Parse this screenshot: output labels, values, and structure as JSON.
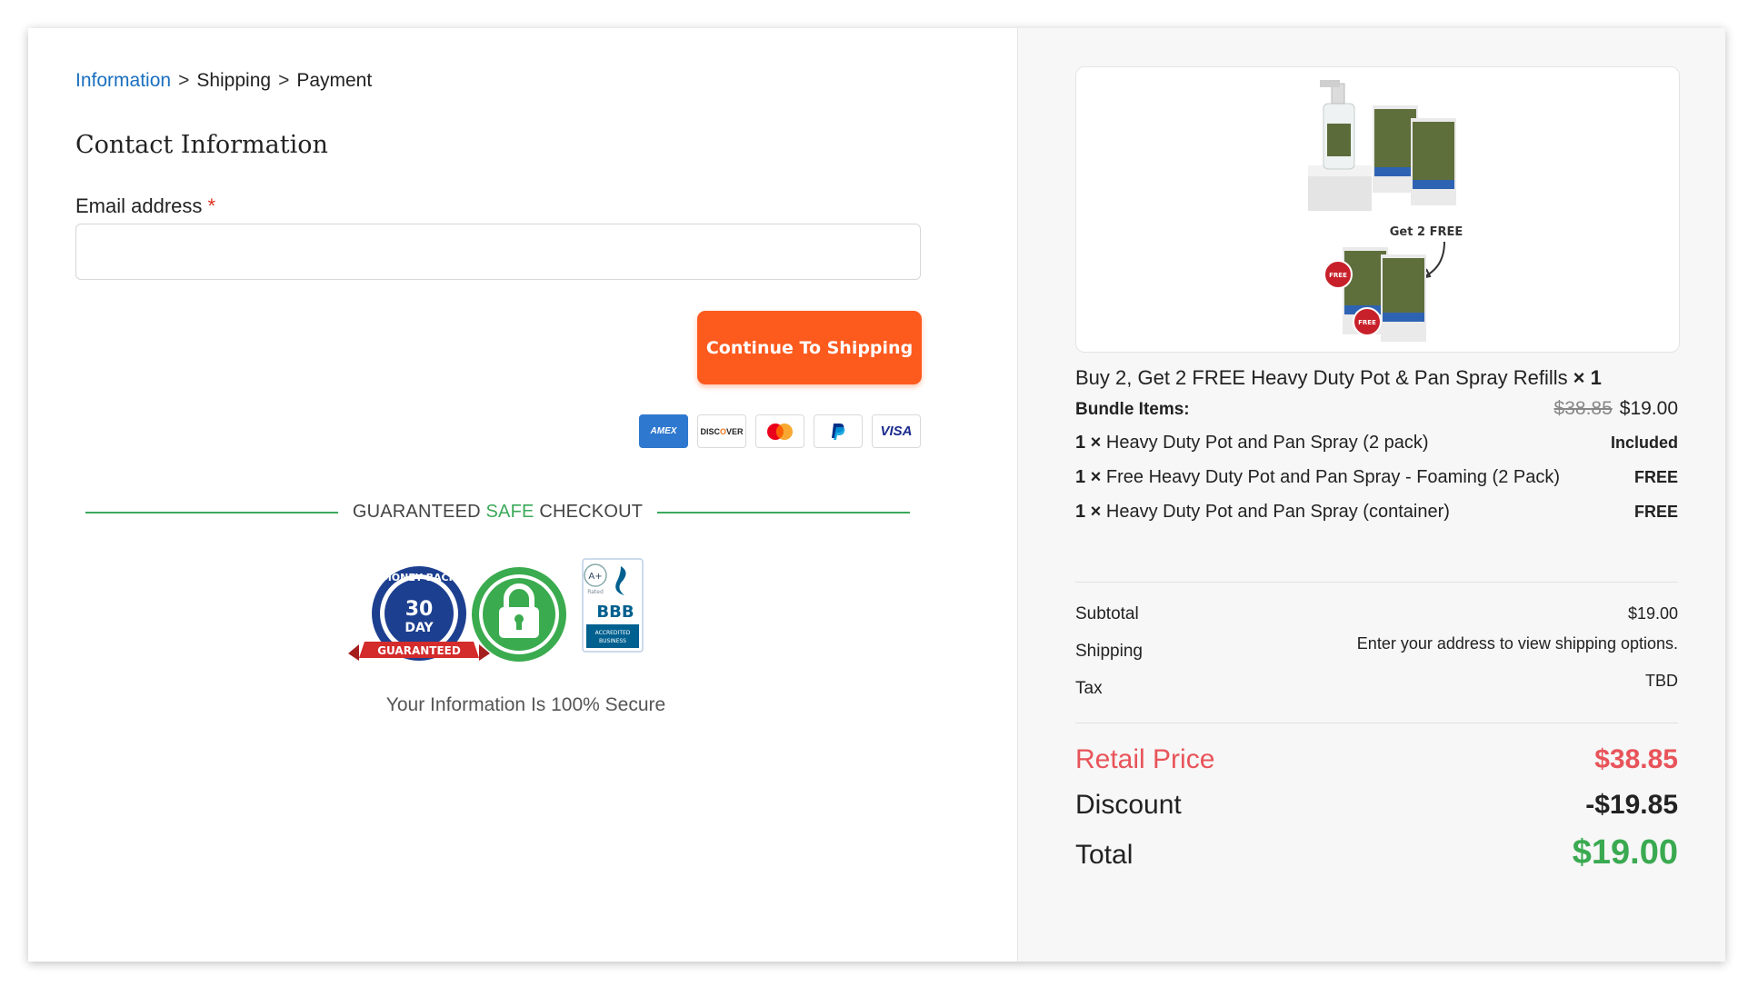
{
  "breadcrumb": {
    "items": [
      "Information",
      "Shipping",
      "Payment"
    ],
    "separator": ">"
  },
  "contact": {
    "title": "Contact Information",
    "email_label": "Email address",
    "required_mark": "*",
    "email_value": "",
    "email_placeholder": ""
  },
  "cta": {
    "label": "Continue To Shipping",
    "color": "#fd5a1e"
  },
  "payment_methods": [
    "AMEX",
    "DISCOVER",
    "MASTERCARD",
    "PAYPAL",
    "VISA"
  ],
  "payment_labels": {
    "amex": "AMEX",
    "discover_pre": "DISC",
    "discover_o": "O",
    "discover_post": "VER",
    "visa": "VISA"
  },
  "guarantee": {
    "pre": "GUARANTEED",
    "safe": "SAFE",
    "post": "CHECKOUT",
    "accent": "#3ba95a"
  },
  "badges": {
    "money_back": {
      "top": "MONEY BACK",
      "num": "30",
      "day": "DAY",
      "ribbon": "GUARANTEED"
    },
    "bbb": {
      "rating": "A+",
      "rated": "Rated",
      "logo": "BBB",
      "sub1": "ACCREDITED",
      "sub2": "BUSINESS"
    }
  },
  "secure_text": "Your Information Is 100% Secure",
  "product": {
    "image_caption": "Get 2 FREE",
    "free_tag": "FREE",
    "title": "Buy 2, Get 2 FREE Heavy Duty Pot & Pan Spray Refills",
    "qty": "× 1",
    "bundle_label": "Bundle Items:",
    "price_old": "$38.85",
    "price_new": "$19.00",
    "items": [
      {
        "qty": "1 ×",
        "name": "Heavy Duty Pot and Pan Spray (2 pack)",
        "tag": "Included"
      },
      {
        "qty": "1 ×",
        "name": "Free Heavy Duty Pot and Pan Spray - Foaming (2 Pack)",
        "tag": "FREE"
      },
      {
        "qty": "1 ×",
        "name": "Heavy Duty Pot and Pan Spray (container)",
        "tag": "FREE"
      }
    ]
  },
  "summary": {
    "subtotal_label": "Subtotal",
    "subtotal_value": "$19.00",
    "shipping_label": "Shipping",
    "shipping_value": "Enter your address to view shipping options.",
    "tax_label": "Tax",
    "tax_value": "TBD"
  },
  "totals": {
    "retail_label": "Retail Price",
    "retail_value": "$38.85",
    "discount_label": "Discount",
    "discount_value": "-$19.85",
    "total_label": "Total",
    "total_value": "$19.00",
    "retail_color": "#e8545a",
    "total_color": "#3aaa51"
  }
}
